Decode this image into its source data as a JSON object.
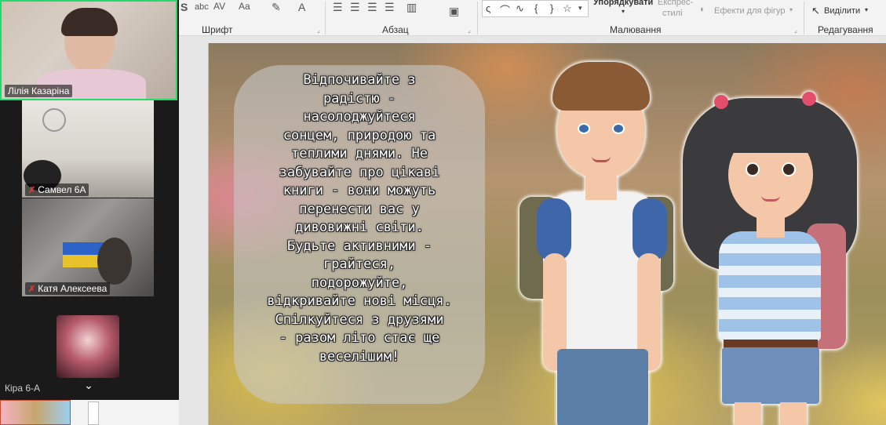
{
  "participants": [
    {
      "name": "Лілія Казаріна",
      "muted": false,
      "active_speaker": true
    },
    {
      "name": "Самвел 6А",
      "muted": true
    },
    {
      "name": "Катя Алексеева",
      "muted": true
    },
    {
      "name": "Кіра 6-А",
      "muted": false
    }
  ],
  "ribbon": {
    "groups": {
      "font": "Шрифт",
      "paragraph": "Абзац",
      "drawing": "Малювання",
      "editing": "Редагування"
    },
    "arrange_label": "Упорядкувати",
    "quick_styles_label_1": "Експрес-",
    "quick_styles_label_2": "стилі",
    "shape_effects_label": "Ефекти для фігур",
    "select_label": "Виділити"
  },
  "slide": {
    "text": "Відпочивайте з\nрадістю -\nнасолоджуйтеся\nсонцем, природою та\nтеплими днями. Не\nзабувайте про цікаві\nкниги - вони можуть\nперенести вас у\nдивовижні світи.\nБудьте активними -\nграйтеся,\nподорожуйте,\nвідкривайте нові місця.\nСпілкуйтеся з друзями\n- разом літо стає ще\nвеселішим!"
  },
  "colors": {
    "active_speaker_border": "#23d96c",
    "muted_icon": "#e53935",
    "panel_bg": "#1a1a1a"
  },
  "icons": {
    "mic_off": "mic-off-icon",
    "expand": "chevron-down-icon"
  }
}
